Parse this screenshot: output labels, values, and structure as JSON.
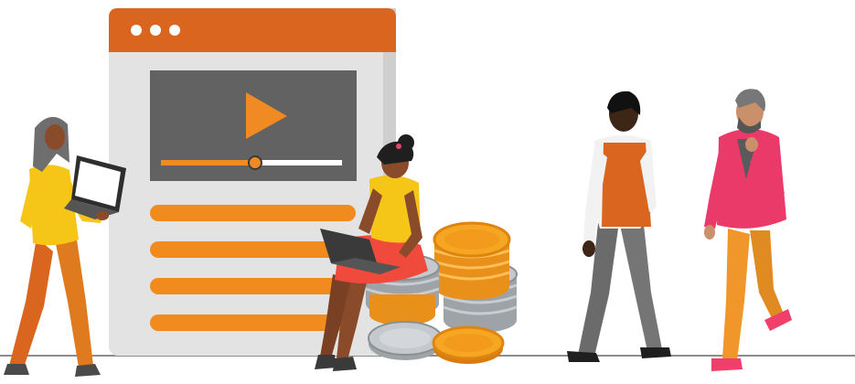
{
  "illustration": {
    "window": {
      "dots": 3,
      "video_progress": 0.52,
      "text_lines": 4
    },
    "colors": {
      "window_header": "#d9651e",
      "window_body": "#e2e2e2",
      "video_panel": "#616161",
      "play_icon": "#f08a23",
      "progress_fill": "#f08a23",
      "text_lines": "#f28b1e",
      "coin_gold": "#f5a623",
      "coin_silver": "#b8bcc0",
      "ground_line": "#9e9e9e"
    },
    "figures": [
      {
        "id": "woman-with-laptop",
        "icon": "person-laptop-icon"
      },
      {
        "id": "woman-sitting-on-coins",
        "icon": "person-sitting-icon"
      },
      {
        "id": "man-in-vest",
        "icon": "person-walking-icon"
      },
      {
        "id": "man-in-pink-jacket",
        "icon": "person-thinking-icon"
      }
    ]
  }
}
